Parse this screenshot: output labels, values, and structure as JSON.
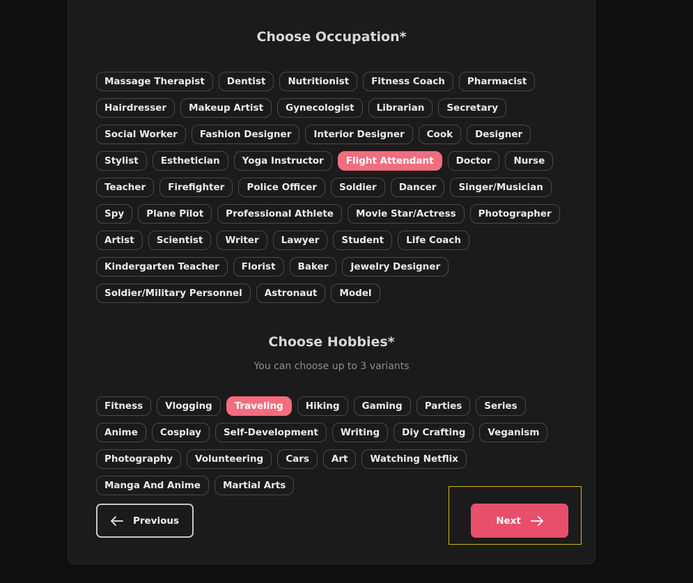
{
  "occupation": {
    "title": "Choose Occupation*",
    "selected": "Flight Attendant",
    "options": [
      "Massage Therapist",
      "Dentist",
      "Nutritionist",
      "Fitness Coach",
      "Pharmacist",
      "Hairdresser",
      "Makeup Artist",
      "Gynecologist",
      "Librarian",
      "Secretary",
      "Social Worker",
      "Fashion Designer",
      "Interior Designer",
      "Cook",
      "Designer",
      "Stylist",
      "Esthetician",
      "Yoga Instructor",
      "Flight Attendant",
      "Doctor",
      "Nurse",
      "Teacher",
      "Firefighter",
      "Police Officer",
      "Soldier",
      "Dancer",
      "Singer/Musician",
      "Spy",
      "Plane Pilot",
      "Professional Athlete",
      "Movie Star/Actress",
      "Photographer",
      "Artist",
      "Scientist",
      "Writer",
      "Lawyer",
      "Student",
      "Life Coach",
      "Kindergarten Teacher",
      "Florist",
      "Baker",
      "Jewelry Designer",
      "Soldier/Military Personnel",
      "Astronaut",
      "Model"
    ]
  },
  "hobbies": {
    "title": "Choose Hobbies*",
    "subtitle": "You can choose up to 3 variants",
    "selected": [
      "Traveling"
    ],
    "options": [
      "Fitness",
      "Vlogging",
      "Traveling",
      "Hiking",
      "Gaming",
      "Parties",
      "Series",
      "Anime",
      "Cosplay",
      "Self-Development",
      "Writing",
      "Diy Crafting",
      "Veganism",
      "Photography",
      "Volunteering",
      "Cars",
      "Art",
      "Watching Netflix",
      "Manga And Anime",
      "Martial Arts"
    ]
  },
  "nav": {
    "previous_label": "Previous",
    "next_label": "Next"
  },
  "colors": {
    "accent": "#f26d7f",
    "next_button": "#e84f6b",
    "focus_outline": "#d8b320"
  },
  "icons": {
    "previous": "arrow-left-icon",
    "next": "arrow-right-icon"
  }
}
